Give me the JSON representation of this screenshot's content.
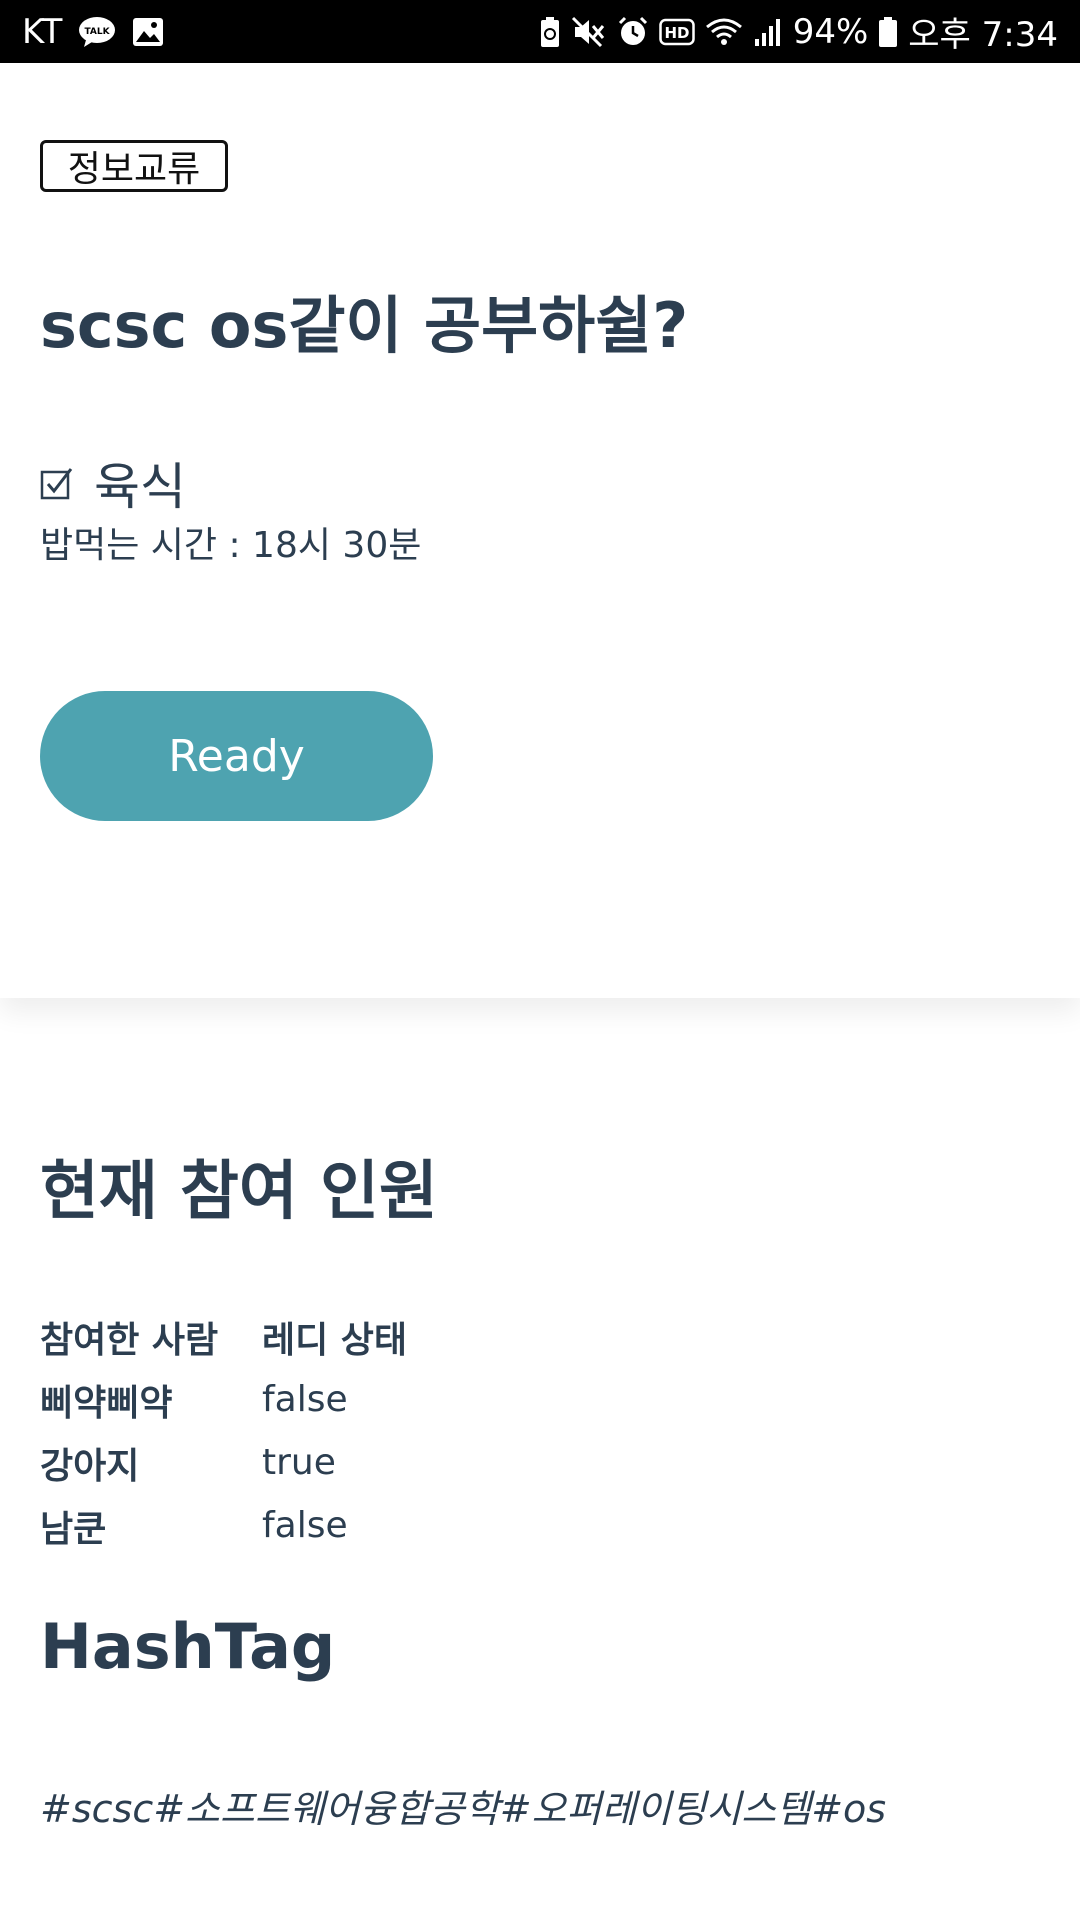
{
  "status_bar": {
    "carrier": "KT",
    "battery_percent": "94%",
    "time": "오후 7:34",
    "icons_left": [
      "kakaotalk-icon",
      "gallery-icon"
    ],
    "icons_right": [
      "battery-saver-icon",
      "mute-icon",
      "alarm-icon",
      "hd-icon",
      "wifi-icon",
      "signal-icon",
      "battery-icon"
    ]
  },
  "post": {
    "category": "정보교류",
    "title": "scsc os같이 공부하쉴?",
    "meal_type": "육식",
    "meal_time": "밥먹는 시간 : 18시 30분",
    "ready_label": "Ready"
  },
  "participants": {
    "title": "현재 참여 인원",
    "headers": [
      "참여한 사람",
      "레디 상태"
    ],
    "rows": [
      {
        "name": "삐약삐약",
        "ready": "false"
      },
      {
        "name": "강아지",
        "ready": "true"
      },
      {
        "name": "남쿤",
        "ready": "false"
      }
    ]
  },
  "hashtag": {
    "title": "HashTag",
    "text": "#scsc#소프트웨어융합공학#오퍼레이팅시스템#os"
  },
  "colors": {
    "accent": "#4ea3b0",
    "text": "#2c3e50",
    "status_bar": "#000000"
  }
}
